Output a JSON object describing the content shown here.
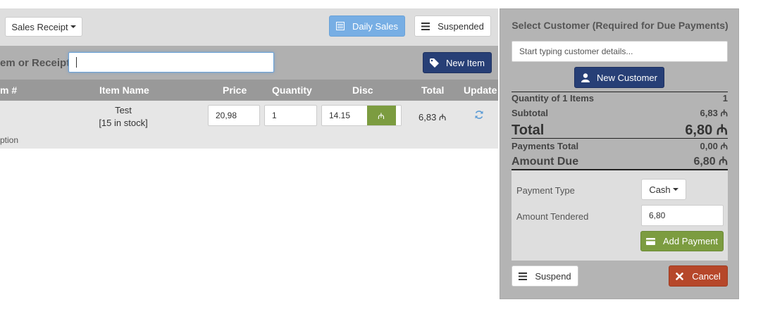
{
  "toolbar": {
    "mode_label": "Sales Receipt",
    "daily_sales_label": "Daily Sales",
    "suspended_label": "Suspended"
  },
  "search": {
    "label": "em or Receipt",
    "value": "",
    "new_item_label": "New Item"
  },
  "table": {
    "headers": [
      "m #",
      "Item Name",
      "Price",
      "Quantity",
      "Disc",
      "Total",
      "Update"
    ],
    "rows": [
      {
        "item_name": "Test",
        "stock": "[15 in stock]",
        "price": "20,98",
        "quantity": "1",
        "discount": "14.15",
        "discount_symbol": "₼",
        "total": "6,83 ₼",
        "description": "ption"
      }
    ]
  },
  "customer": {
    "title": "Select Customer (Required for Due Payments)",
    "placeholder": "Start typing customer details...",
    "new_customer_label": "New Customer"
  },
  "summary": {
    "quantity_label": "Quantity of 1 Items",
    "quantity_value": "1",
    "subtotal_label": "Subtotal",
    "subtotal_value": "6,83 ₼",
    "total_label": "Total",
    "total_value": "6,80 ₼",
    "payments_total_label": "Payments Total",
    "payments_total_value": "0,00 ₼",
    "amount_due_label": "Amount Due",
    "amount_due_value": "6,80 ₼"
  },
  "payment": {
    "type_label": "Payment Type",
    "type_value": "Cash",
    "tendered_label": "Amount Tendered",
    "tendered_value": "6,80",
    "add_payment_label": "Add Payment"
  },
  "actions": {
    "suspend_label": "Suspend",
    "cancel_label": "Cancel"
  },
  "colors": {
    "navy": "#273f76",
    "info": "#77aee4",
    "olive": "#7c9c40",
    "danger": "#b6472a"
  },
  "icons": [
    "calendar-icon",
    "list-icon",
    "tag-icon",
    "refresh-icon",
    "user-icon",
    "credit-card-icon",
    "close-icon"
  ]
}
